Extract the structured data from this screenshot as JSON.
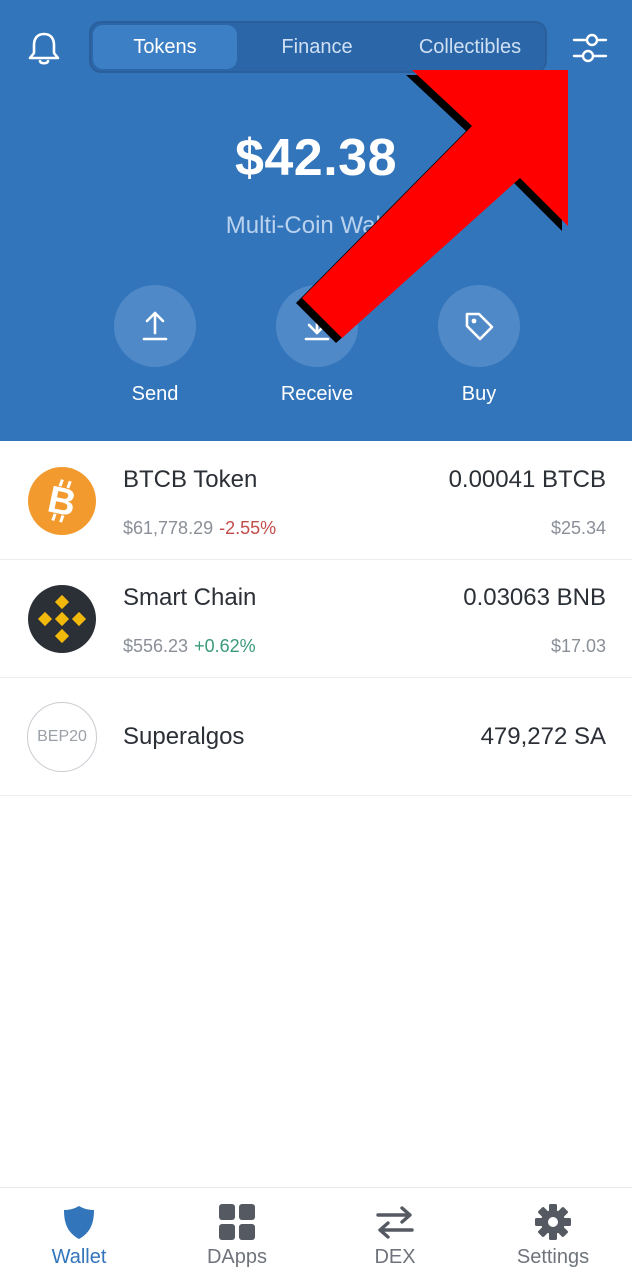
{
  "header": {
    "tabs": [
      {
        "label": "Tokens",
        "active": true
      },
      {
        "label": "Finance",
        "active": false
      },
      {
        "label": "Collectibles",
        "active": false
      }
    ],
    "balance": "$42.38",
    "wallet_name": "Multi-Coin Wallet",
    "actions": [
      {
        "label": "Send",
        "icon": "upload-icon"
      },
      {
        "label": "Receive",
        "icon": "download-icon"
      },
      {
        "label": "Buy",
        "icon": "tag-icon"
      }
    ],
    "left_icon": "bell-icon",
    "right_icon": "filter-settings-icon"
  },
  "tokens": [
    {
      "name": "BTCB Token",
      "price": "$61,778.29",
      "change": "-2.55%",
      "amount": "0.00041 BTCB",
      "value": "$25.34",
      "icon": "bitcoin-icon"
    },
    {
      "name": "Smart Chain",
      "price": "$556.23",
      "change": "+0.62%",
      "amount": "0.03063 BNB",
      "value": "$17.03",
      "icon": "bnb-icon"
    },
    {
      "name": "Superalgos",
      "amount": "479,272 SA",
      "icon_text": "BEP20"
    }
  ],
  "bottom_nav": [
    {
      "label": "Wallet",
      "icon": "shield-icon",
      "active": true
    },
    {
      "label": "DApps",
      "icon": "grid-icon",
      "active": false
    },
    {
      "label": "DEX",
      "icon": "swap-arrows-icon",
      "active": false
    },
    {
      "label": "Settings",
      "icon": "gear-icon",
      "active": false
    }
  ],
  "colors": {
    "header_bg": "#3375bb",
    "accent": "#3375bb",
    "negative": "#c14c4a",
    "positive": "#3b9a7a",
    "annotation_arrow": "#ff0000"
  }
}
